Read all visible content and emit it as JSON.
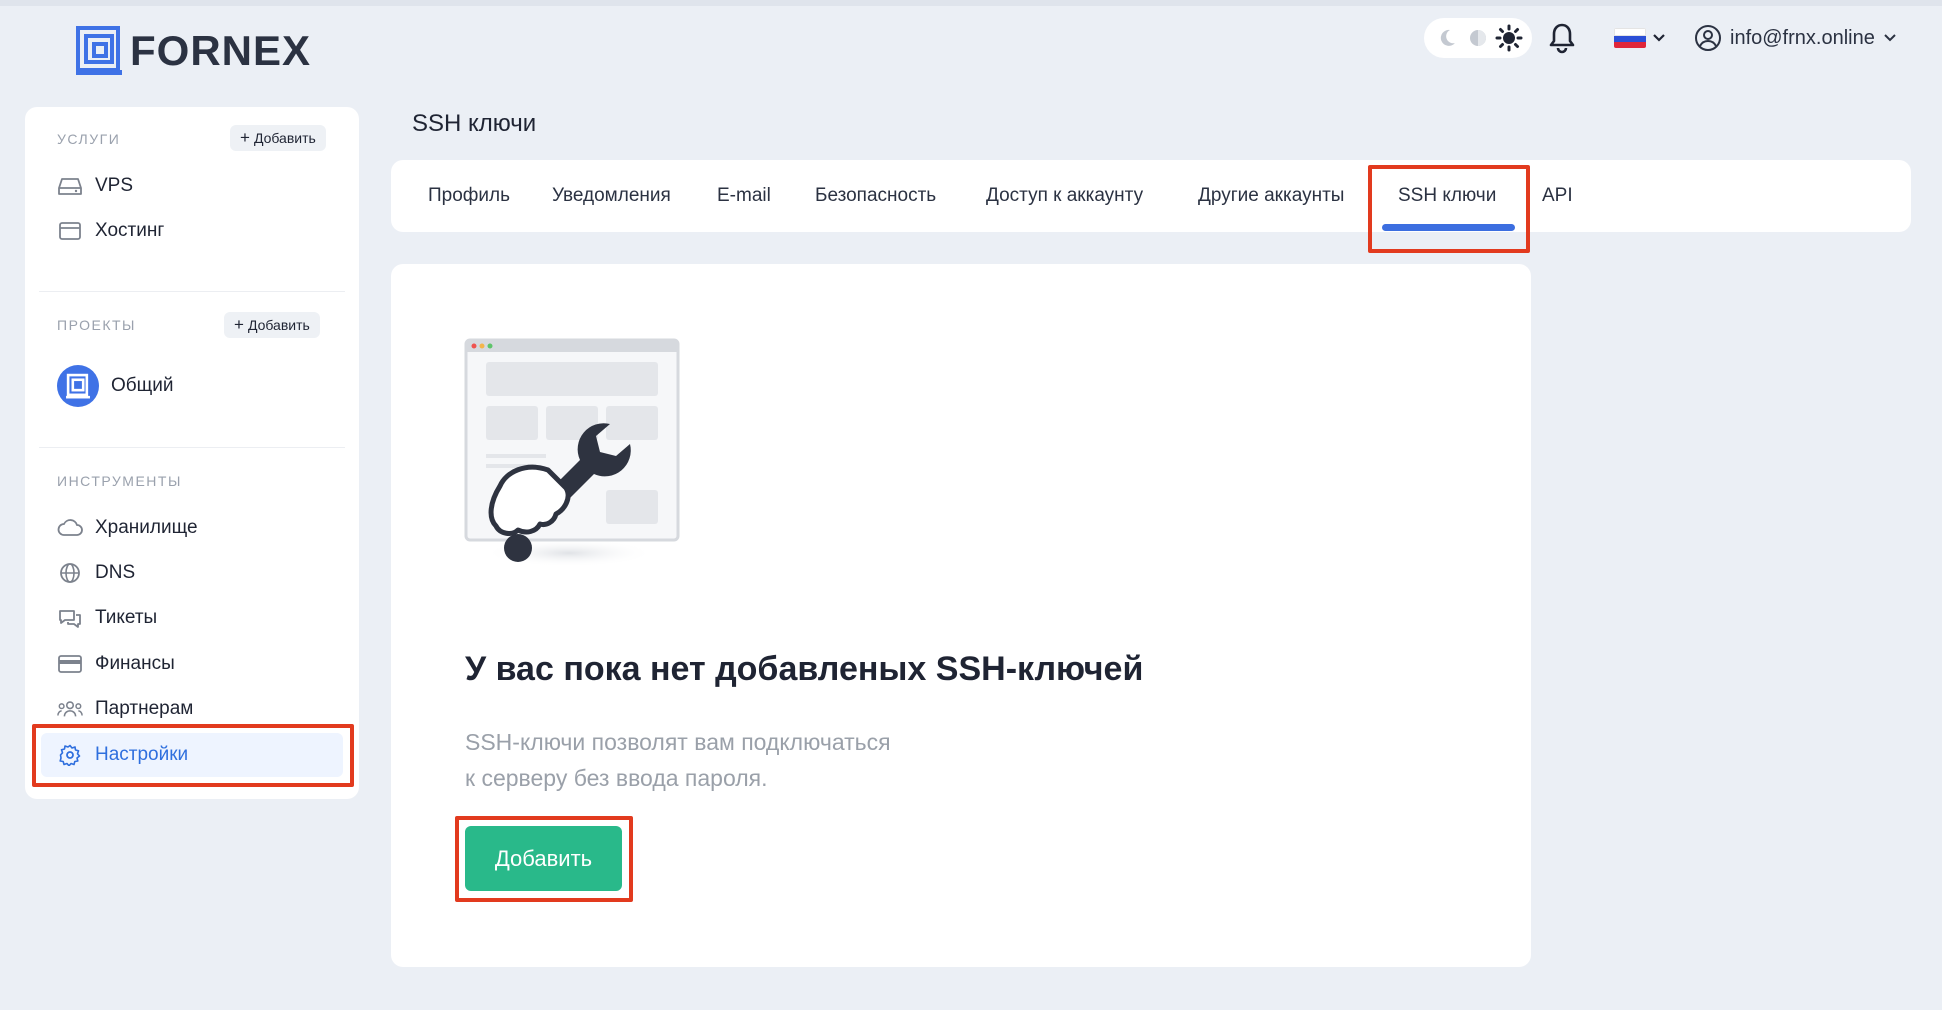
{
  "brand": {
    "name": "FORNEX"
  },
  "header": {
    "theme_modes": [
      "moon-icon",
      "auto-icon",
      "sun-icon"
    ],
    "user_email": "info@frnx.online",
    "language_flag": "ru"
  },
  "sidebar": {
    "services": {
      "heading": "УСЛУГИ",
      "add_label": "Добавить",
      "items": [
        {
          "label": "VPS",
          "icon": "server-icon"
        },
        {
          "label": "Хостинг",
          "icon": "browser-window-icon"
        }
      ]
    },
    "projects": {
      "heading": "ПРОЕКТЫ",
      "add_label": "Добавить",
      "items": [
        {
          "label": "Общий",
          "icon": "project-logo-icon"
        }
      ]
    },
    "tools": {
      "heading": "ИНСТРУМЕНТЫ",
      "items": [
        {
          "label": "Хранилище",
          "icon": "cloud-icon"
        },
        {
          "label": "DNS",
          "icon": "globe-icon"
        },
        {
          "label": "Тикеты",
          "icon": "chat-icon"
        },
        {
          "label": "Финансы",
          "icon": "credit-card-icon"
        },
        {
          "label": "Партнерам",
          "icon": "users-icon"
        },
        {
          "label": "Настройки",
          "icon": "gear-icon",
          "active": true
        }
      ]
    }
  },
  "main": {
    "title": "SSH ключи",
    "tabs": [
      {
        "label": "Профиль"
      },
      {
        "label": "Уведомления"
      },
      {
        "label": "E-mail"
      },
      {
        "label": "Безопасность"
      },
      {
        "label": "Доступ к аккаунту"
      },
      {
        "label": "Другие аккаунты"
      },
      {
        "label": "SSH ключи",
        "active": true
      },
      {
        "label": "API"
      }
    ],
    "empty_state": {
      "title": "У вас пока нет добавленых SSH-ключей",
      "description_line1": "SSH-ключи позволят вам подключаться",
      "description_line2": "к серверу без ввода пароля.",
      "button_label": "Добавить"
    }
  },
  "colors": {
    "accent_blue": "#3c6ee0",
    "primary_green": "#29b98a",
    "highlight_red": "#e23a1e",
    "background": "#ebeff5"
  }
}
